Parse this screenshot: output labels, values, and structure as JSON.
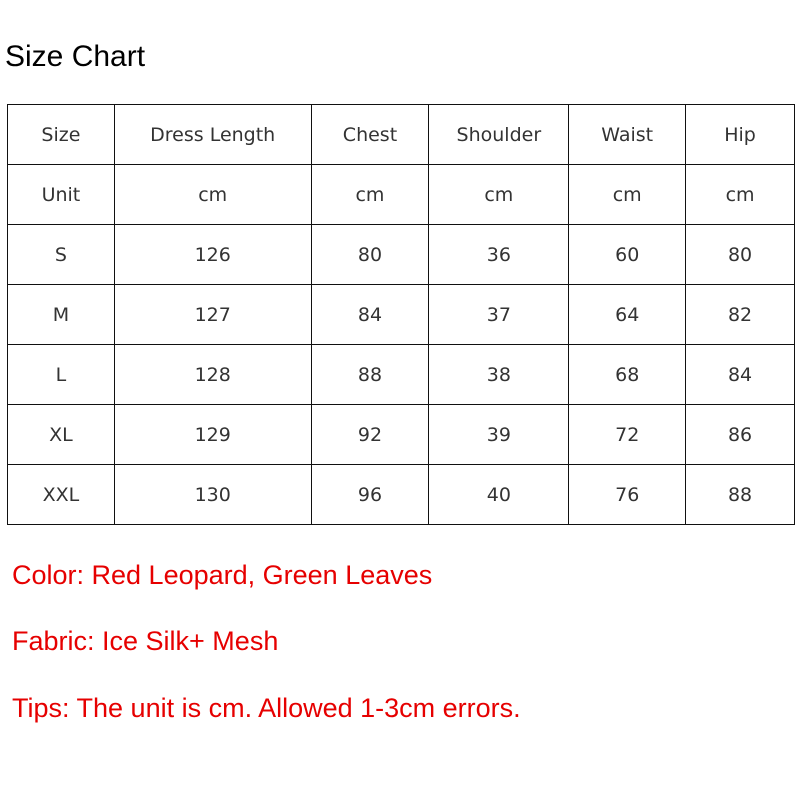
{
  "title": "Size Chart",
  "table": {
    "headers": [
      "Size",
      "Dress Length",
      "Chest",
      "Shoulder",
      "Waist",
      "Hip"
    ],
    "units": [
      "Unit",
      "cm",
      "cm",
      "cm",
      "cm",
      "cm"
    ],
    "rows": [
      [
        "S",
        "126",
        "80",
        "36",
        "60",
        "80"
      ],
      [
        "M",
        "127",
        "84",
        "37",
        "64",
        "82"
      ],
      [
        "L",
        "128",
        "88",
        "38",
        "68",
        "84"
      ],
      [
        "XL",
        "129",
        "92",
        "39",
        "72",
        "86"
      ],
      [
        "XXL",
        "130",
        "96",
        "40",
        "76",
        "88"
      ]
    ]
  },
  "info": {
    "color": "Color: Red Leopard, Green Leaves",
    "fabric": "Fabric: Ice Silk+ Mesh",
    "tips": "Tips: The unit is cm. Allowed 1-3cm errors."
  },
  "colors": {
    "info_text": "#e60000"
  }
}
